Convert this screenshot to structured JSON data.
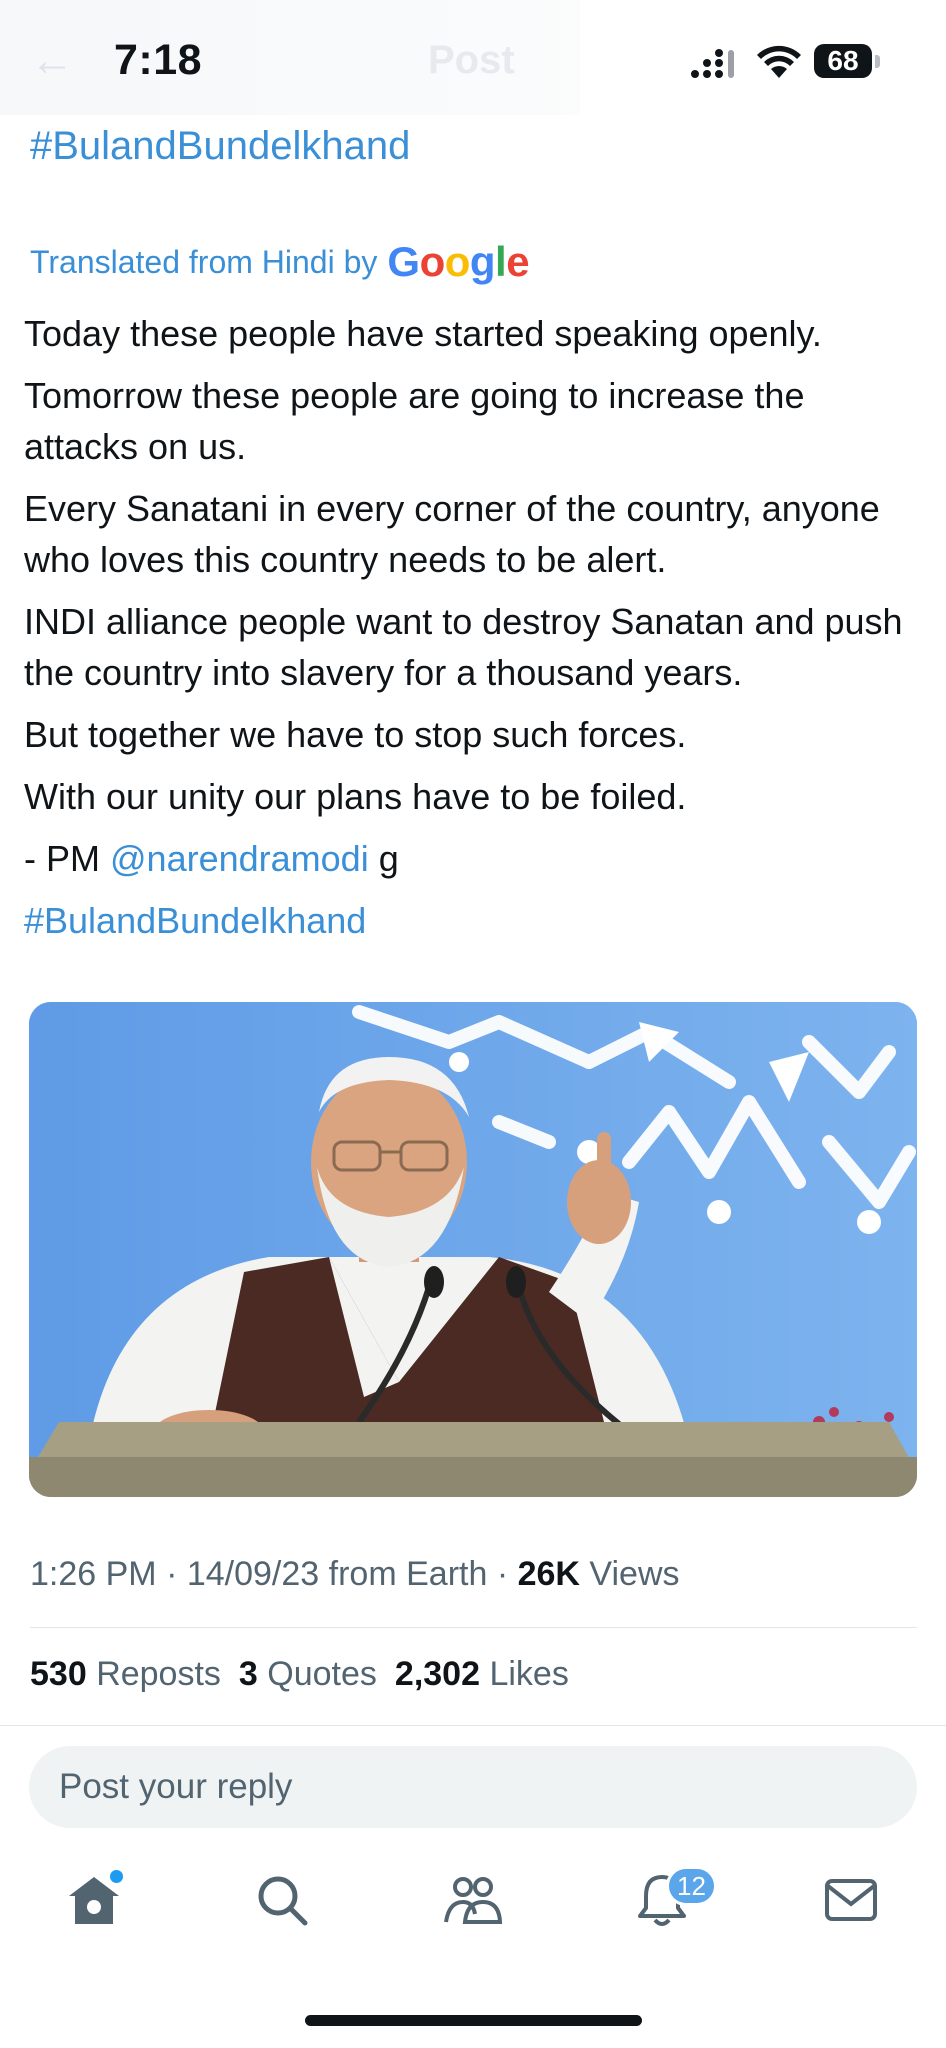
{
  "status_bar": {
    "time": "7:18",
    "battery": "68",
    "ghost_title": "Post"
  },
  "post": {
    "hashtag_top": "#BulandBundelkhand",
    "translated_label": "Translated from Hindi by",
    "translator_brand": "Google",
    "lines": [
      "Today these people have started speaking openly.",
      "Tomorrow these people are going to increase the attacks on us.",
      "Every Sanatani in every corner of the country, anyone who loves this country needs to be alert.",
      "INDI alliance people want to destroy Sanatan and push the country into slavery for a thousand years.",
      "But together we have to stop such forces.",
      "With our unity our plans have to be foiled."
    ],
    "signature_prefix": "- PM",
    "signature_mention": "@narendramodi",
    "signature_suffix": "g",
    "hashtag_bottom": "#BulandBundelkhand",
    "meta": {
      "time": "1:26 PM",
      "date": "14/09/23",
      "source": "from Earth",
      "views_count": "26K",
      "views_label": "Views"
    },
    "stats": {
      "reposts_count": "530",
      "reposts_label": "Reposts",
      "quotes_count": "3",
      "quotes_label": "Quotes",
      "likes_count": "2,302",
      "likes_label": "Likes"
    }
  },
  "reply": {
    "placeholder": "Post your reply"
  },
  "tabbar": {
    "notifications_badge": "12",
    "items": [
      "home-icon",
      "search-icon",
      "communities-icon",
      "notifications-icon",
      "messages-icon"
    ]
  },
  "colors": {
    "link": "#3a8fd6",
    "text": "#0f1419",
    "secondary": "#536471",
    "badge": "#5ba6ea"
  }
}
